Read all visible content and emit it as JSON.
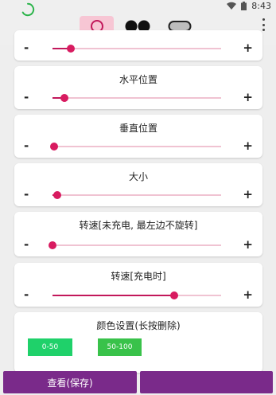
{
  "status": {
    "time": "8:43"
  },
  "shape_tabs": [
    {
      "name": "circle-shape-tab",
      "icon": "circle-icon",
      "active": true
    },
    {
      "name": "dots-shape-tab",
      "icon": "two-dots-icon",
      "active": false
    },
    {
      "name": "pill-shape-tab",
      "icon": "pill-icon",
      "active": false
    }
  ],
  "sliders": [
    {
      "title": "",
      "minus": "-",
      "plus": "+",
      "value_fraction": 0.11
    },
    {
      "title": "水平位置",
      "minus": "-",
      "plus": "+",
      "value_fraction": 0.07
    },
    {
      "title": "垂直位置",
      "minus": "-",
      "plus": "+",
      "value_fraction": 0.01
    },
    {
      "title": "大小",
      "minus": "-",
      "plus": "+",
      "value_fraction": 0.03
    },
    {
      "title": "转速[未充电, 最左边不旋转]",
      "minus": "-",
      "plus": "+",
      "value_fraction": 0.0
    },
    {
      "title": "转速[充电时]",
      "minus": "-",
      "plus": "+",
      "value_fraction": 0.72
    }
  ],
  "color_settings": {
    "title": "颜色设置(长按删除)",
    "swatches": [
      {
        "label": "0-50",
        "color": "#1fd16a"
      },
      {
        "label": "50-100",
        "color": "#39c24a"
      }
    ]
  },
  "buttons": {
    "view_save": "查看(保存)"
  },
  "colors": {
    "accent": "#d81b60",
    "bottom_button": "#7a2a8a",
    "active_tab": "#f7c6d4"
  }
}
